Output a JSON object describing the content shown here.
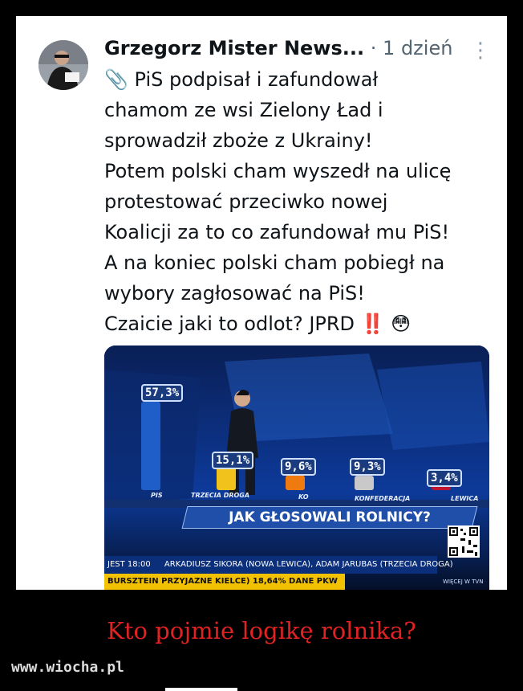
{
  "post": {
    "author": "Grzegorz Mister News...",
    "separator": "·",
    "time": "1 dzień",
    "more_icon": "more-options-icon",
    "lines": [
      "📎 PiS podpisał i zafundował",
      "chamom ze wsi Zielony Ład i",
      "sprowadził zboże z Ukrainy!",
      "Potem polski cham wyszedł na ulicę",
      "protestować przeciwko nowej",
      "Koalicji za to co zafundował mu PiS!",
      "A na koniec polski cham pobiegł na",
      "wybory zagłosować na PiS!",
      "Czaicie jaki to odlot? JPRD ‼️ 😳"
    ]
  },
  "tv": {
    "parties": [
      {
        "name": "PIS",
        "value": "57,3%",
        "color": "#1f5ec9"
      },
      {
        "name": "TRZECIA DROGA",
        "value": "15,1%",
        "color": "#f1c21b"
      },
      {
        "name": "KO",
        "value": "9,6%",
        "color": "#ee7a10"
      },
      {
        "name": "KONFEDERACJA",
        "value": "9,3%",
        "color": "#c9c9c9"
      },
      {
        "name": "LEWICA",
        "value": "3,4%",
        "color": "#c0152f"
      }
    ],
    "banner": "JAK GŁOSOWALI ROLNICY?",
    "ticker_time": "JEST 18:00",
    "ticker_text": "ARKADIUSZ SIKORA (NOWA LEWICA), ADAM JARUBAS (TRZECIA DROGA)",
    "ticker2": "BURSZTEIN PRZYJAZNE KIELCE) 18,64%   DANE PKW",
    "qr_label": "WIĘCEJ W TVN"
  },
  "caption": "Kto pojmie logikę rolnika?",
  "site": "www.wiocha.pl"
}
